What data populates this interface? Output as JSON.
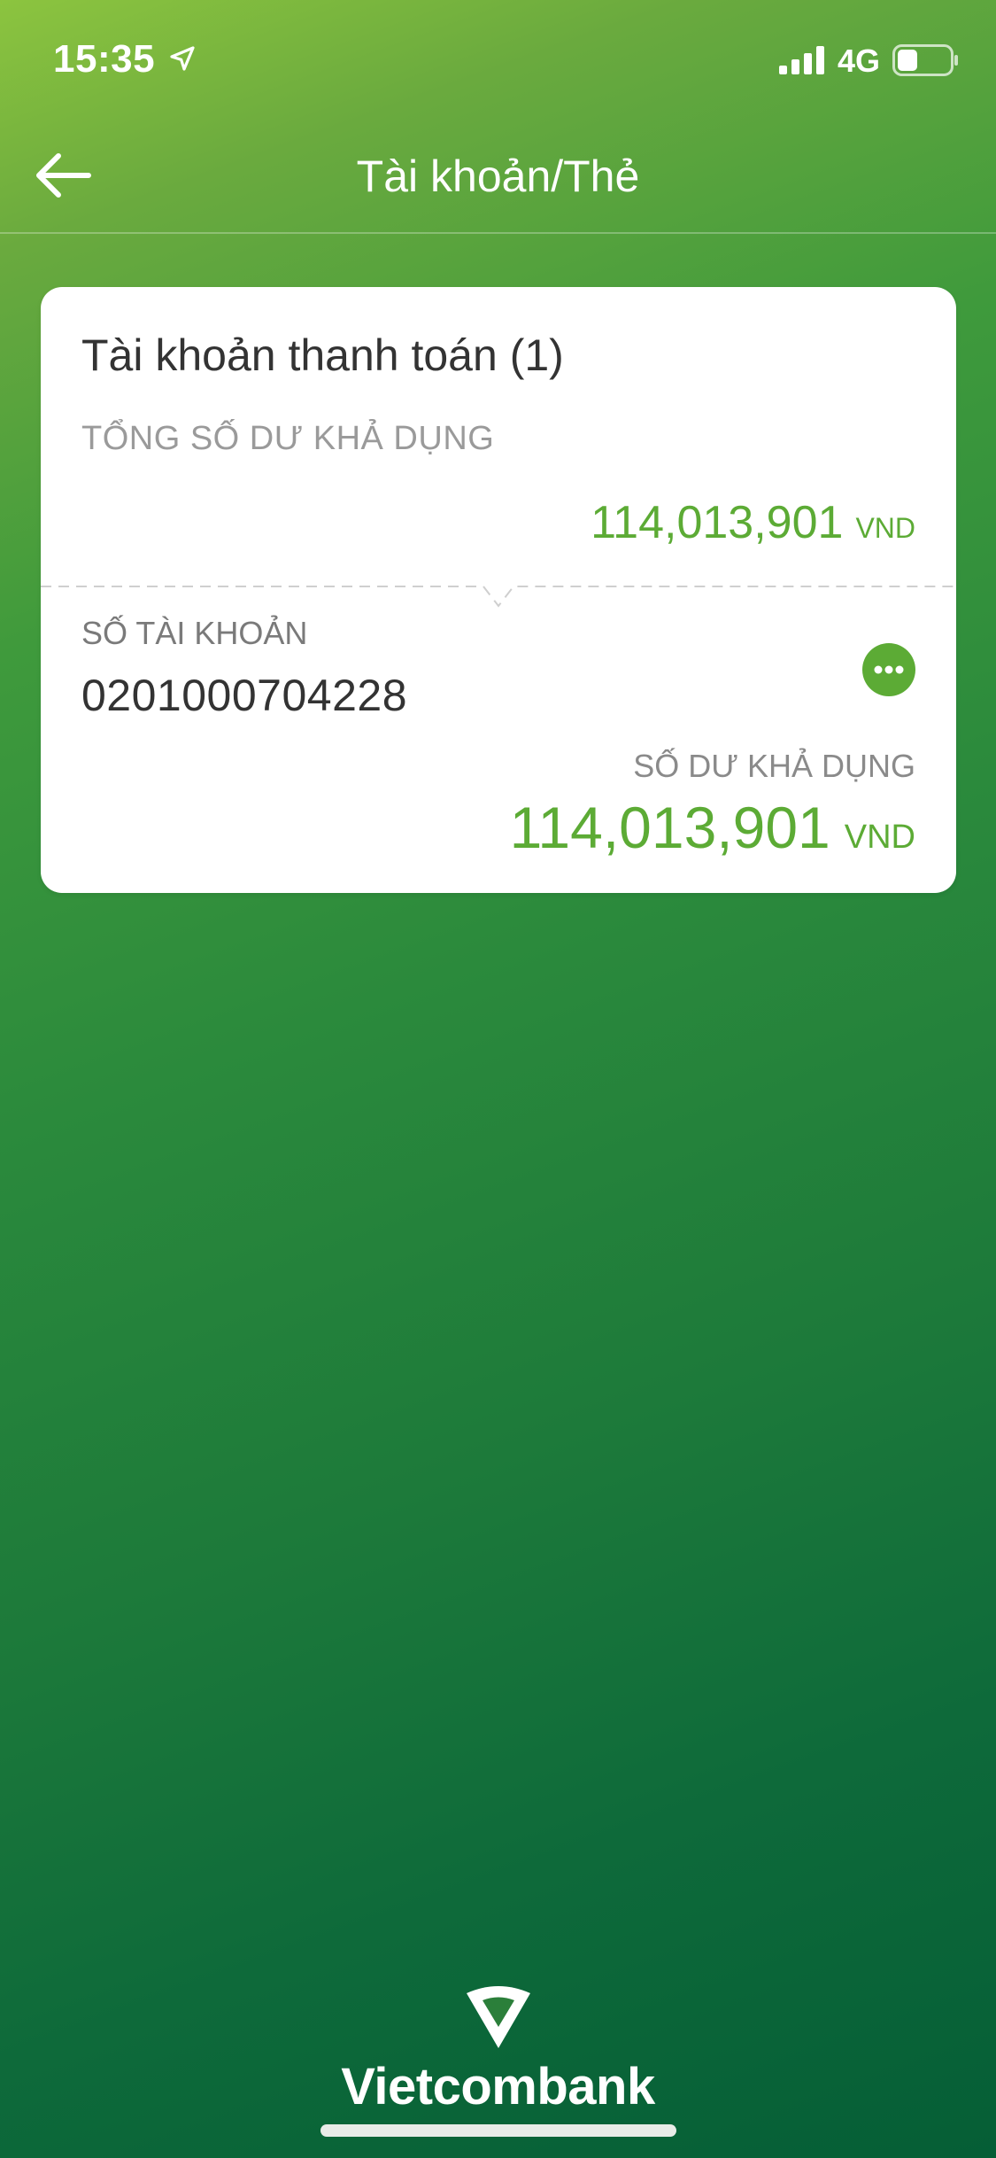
{
  "status_bar": {
    "time": "15:35",
    "network": "4G",
    "location_icon": "location-arrow-icon",
    "signal_icon": "cellular-signal-icon",
    "battery_icon": "battery-icon"
  },
  "nav": {
    "title": "Tài khoản/Thẻ",
    "back_icon": "arrow-left-icon"
  },
  "account_section": {
    "title": "Tài khoản thanh toán (1)",
    "total_label": "TỔNG SỐ DƯ KHẢ DỤNG",
    "total_amount": "114,013,901",
    "total_currency": "VND",
    "accounts": [
      {
        "number_label": "SỐ TÀI KHOẢN",
        "number": "0201000704228",
        "available_label": "SỐ DƯ KHẢ DỤNG",
        "available_amount": "114,013,901",
        "available_currency": "VND",
        "more_icon": "more-horizontal-icon"
      }
    ]
  },
  "footer": {
    "logo_text": "Vietcombank"
  },
  "colors": {
    "accent": "#5cab35",
    "gradient_start": "#8cc43f",
    "gradient_end": "#055e36",
    "card_bg": "#ffffff"
  }
}
